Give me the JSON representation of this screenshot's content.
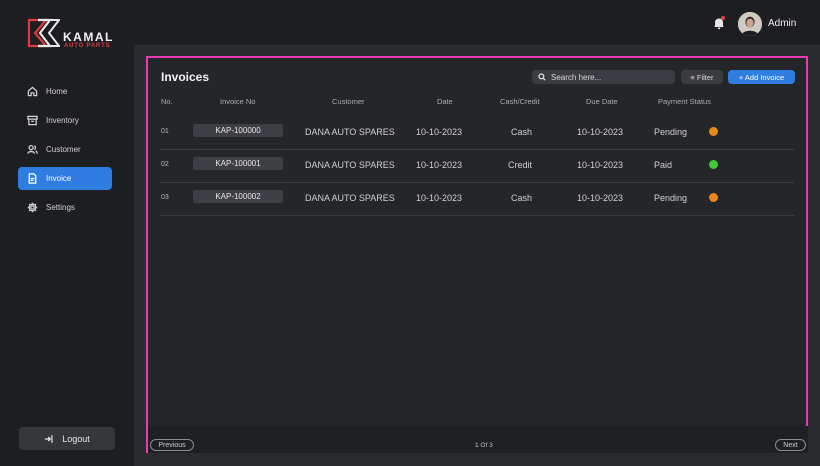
{
  "brand": {
    "name": "KAMAL",
    "tagline": "AUTO PARTS"
  },
  "sidebar": {
    "items": [
      {
        "label": "Home",
        "icon": "home-icon"
      },
      {
        "label": "Inventory",
        "icon": "inventory-icon"
      },
      {
        "label": "Customer",
        "icon": "customer-icon"
      },
      {
        "label": "Invoice",
        "icon": "invoice-icon",
        "active": true
      },
      {
        "label": "Settings",
        "icon": "settings-icon"
      }
    ],
    "logout_label": "Logout"
  },
  "header": {
    "user_name": "Admin"
  },
  "main": {
    "title": "Invoices",
    "search_placeholder": "Search here...",
    "filter_label": "≡ Filter",
    "add_label": "+ Add Invoice",
    "columns": [
      "No.",
      "Invoice No",
      "Customer",
      "Date",
      "Cash/Credit",
      "Due Date",
      "Payment Status"
    ],
    "rows": [
      {
        "no": "01",
        "invoice_no": "KAP-100000",
        "customer": "DANA AUTO SPARES",
        "date": "10-10-2023",
        "payment_type": "Cash",
        "due_date": "10-10-2023",
        "status": "Pending"
      },
      {
        "no": "02",
        "invoice_no": "KAP-100001",
        "customer": "DANA AUTO SPARES",
        "date": "10-10-2023",
        "payment_type": "Credit",
        "due_date": "10-10-2023",
        "status": "Paid"
      },
      {
        "no": "03",
        "invoice_no": "KAP-100002",
        "customer": "DANA AUTO SPARES",
        "date": "10-10-2023",
        "payment_type": "Cash",
        "due_date": "10-10-2023",
        "status": "Pending"
      }
    ],
    "pagination": {
      "prev_label": "Previous",
      "page_text": "1 Of 3",
      "next_label": "Next"
    }
  },
  "colors": {
    "accent": "#2f7de1",
    "pending": "#e8891a",
    "paid": "#3ec83a",
    "highlight": "#e73cb4"
  }
}
